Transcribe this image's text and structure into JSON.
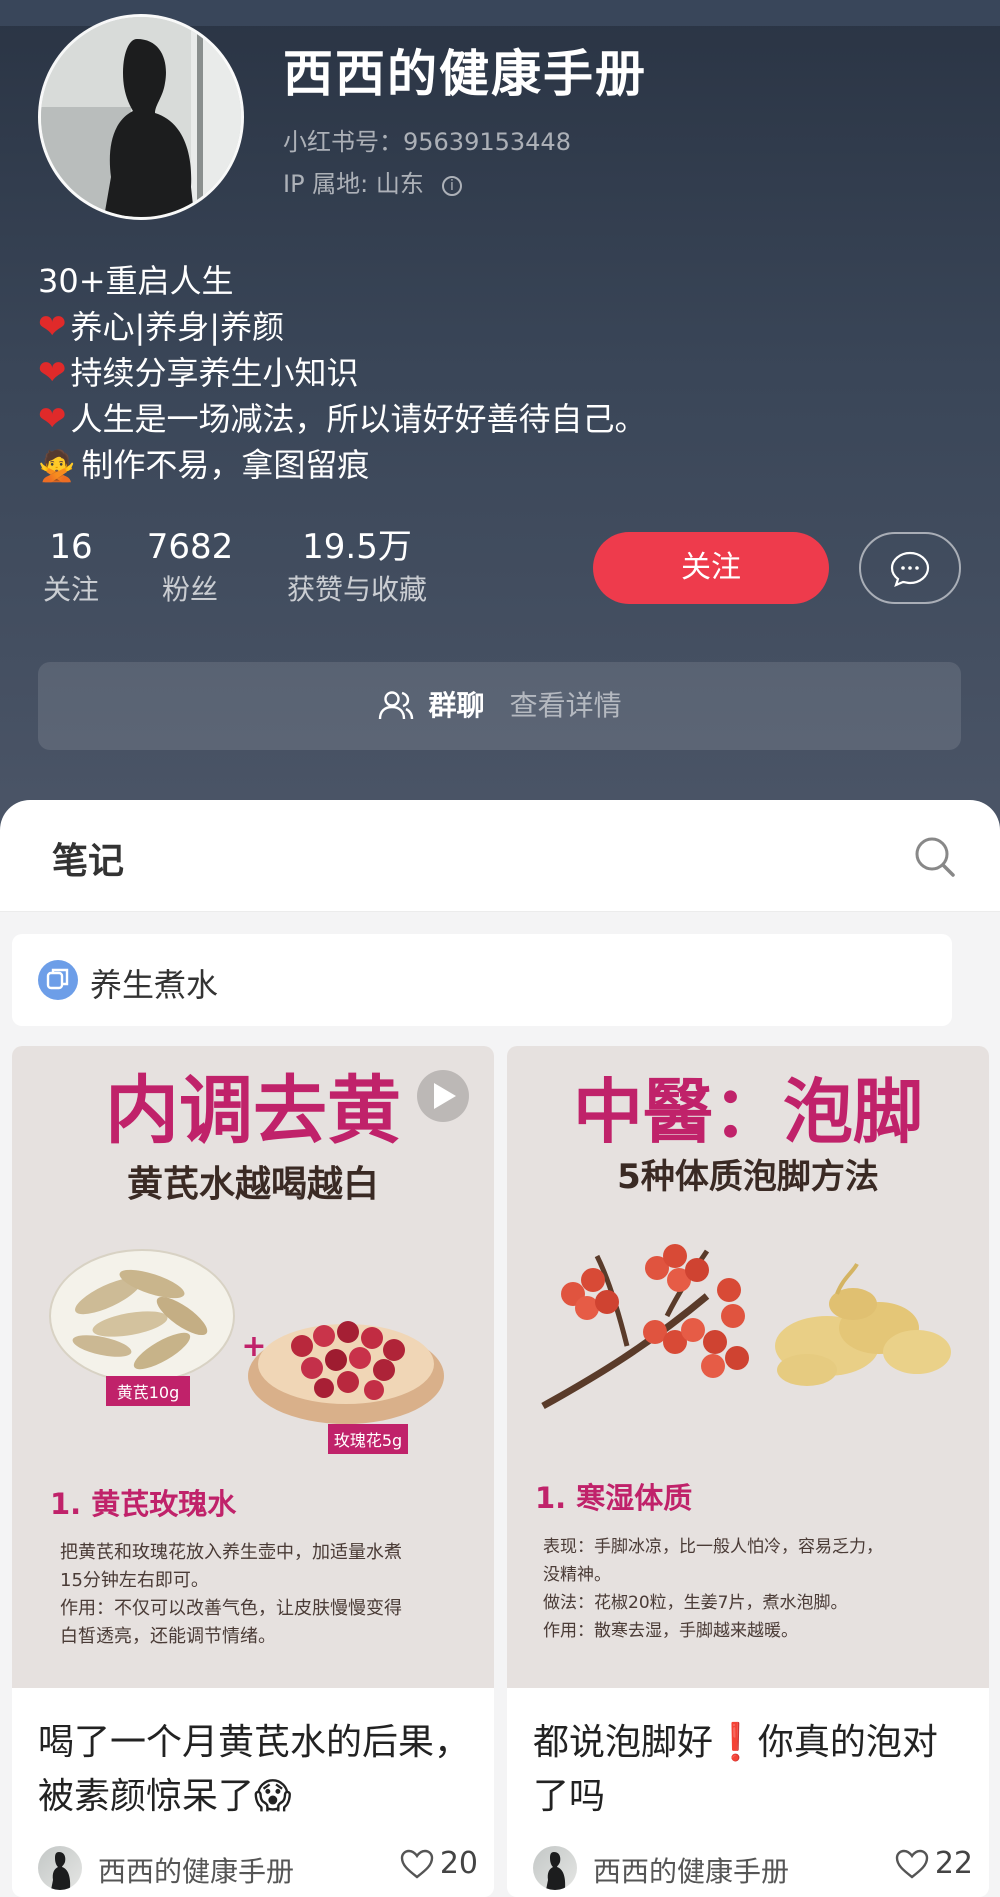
{
  "profile": {
    "name": "西西的健康手册",
    "id_text": "小红书号：95639153448",
    "ip_text": "IP 属地: 山东",
    "bio_first": "30+重启人生",
    "bio_lines": [
      "养心|养身|养颜",
      "持续分享养生小知识",
      "人生是一场减法，所以请好好善待自己。",
      "制作不易，拿图留痕"
    ]
  },
  "stats": [
    {
      "num": "16",
      "label": "关注"
    },
    {
      "num": "7682",
      "label": "粉丝"
    },
    {
      "num": "19.5万",
      "label": "获赞与收藏"
    }
  ],
  "buttons": {
    "follow": "关注"
  },
  "group_chat": {
    "title": "群聊",
    "sub": "查看详情"
  },
  "notes": {
    "tab": "笔记",
    "collection": "养生煮水"
  },
  "cards": [
    {
      "image": {
        "headline": "内调去黄",
        "subhead": "黄芪水越喝越白",
        "tag1": "黄芪10g",
        "tag2": "玫瑰花5g",
        "section": "1. 黄芪玫瑰水",
        "body": [
          "把黄芪和玫瑰花放入养生壶中，加适量水煮",
          "15分钟左右即可。",
          "作用：不仅可以改善气色，让皮肤慢慢变得",
          "白皙透亮，还能调节情绪。"
        ]
      },
      "title": "喝了一个月黄芪水的后果，被素颜惊呆了😱",
      "author": "西西的健康手册",
      "likes": "20"
    },
    {
      "image": {
        "headline": "中醫：泡脚",
        "subhead": "5种体质泡脚方法",
        "section": "1. 寒湿体质",
        "body": [
          "表现：手脚冰凉，比一般人怕冷，容易乏力，",
          "没精神。",
          "做法：花椒20粒，生姜7片，煮水泡脚。",
          "作用：散寒去湿，手脚越来越暖。"
        ]
      },
      "title": "都说泡脚好❗️你真的泡对了吗",
      "author": "西西的健康手册",
      "likes": "22"
    }
  ],
  "colors": {
    "accent": "#ee3b4c",
    "header_bg": "#3a4658",
    "poster_title": "#c0226a"
  },
  "icons": [
    "info-icon",
    "heart-icon",
    "message-icon",
    "group-icon",
    "search-icon",
    "collection-icon",
    "play-icon",
    "like-icon"
  ]
}
